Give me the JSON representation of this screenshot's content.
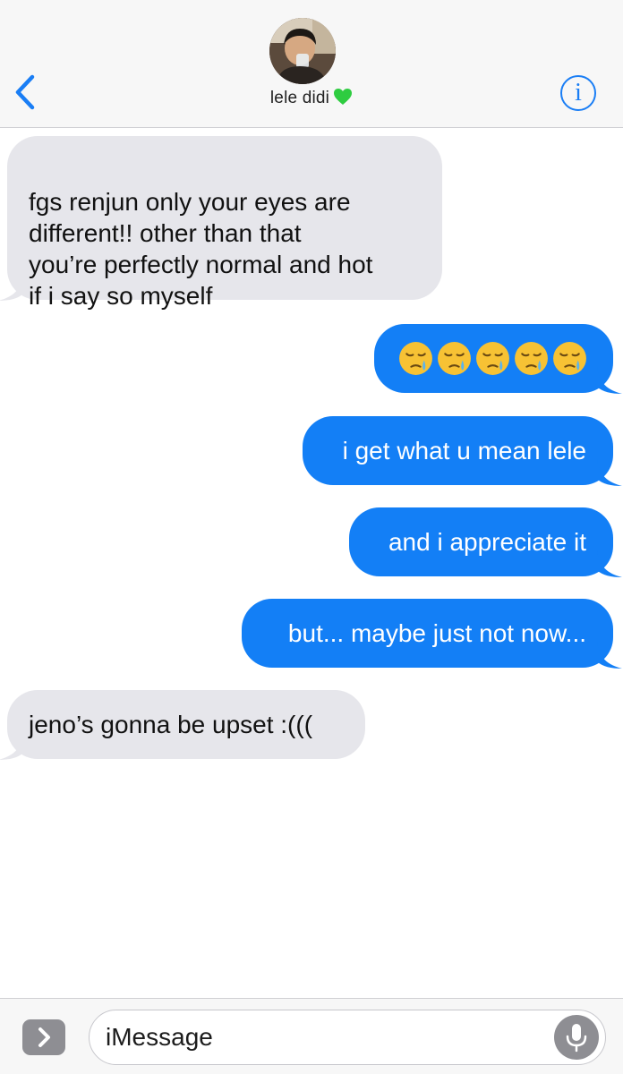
{
  "header": {
    "contact_name": "lele didi",
    "info_label": "i"
  },
  "messages": [
    {
      "direction": "incoming",
      "text": "fgs renjun only your eyes are\ndifferent!! other than that\nyou’re perfectly normal and hot\nif i say so myself"
    },
    {
      "direction": "outgoing",
      "emoji": "sleepy-face",
      "emoji_count": 5
    },
    {
      "direction": "outgoing",
      "text": "i get what u mean lele"
    },
    {
      "direction": "outgoing",
      "text": "and i appreciate it"
    },
    {
      "direction": "outgoing",
      "text": "but... maybe just not now..."
    },
    {
      "direction": "incoming",
      "text": "jeno’s gonna be upset :((("
    }
  ],
  "input": {
    "placeholder": "iMessage"
  },
  "icons": {
    "back": "chevron-left-icon",
    "info": "info-icon",
    "expand": "chevron-right-icon",
    "mic": "microphone-icon",
    "heart": "green-heart-icon"
  },
  "colors": {
    "accent": "#1a7ef5",
    "outgoing_bubble": "#137ff6",
    "incoming_bubble": "#e6e6eb",
    "heart": "#2ecc40"
  }
}
